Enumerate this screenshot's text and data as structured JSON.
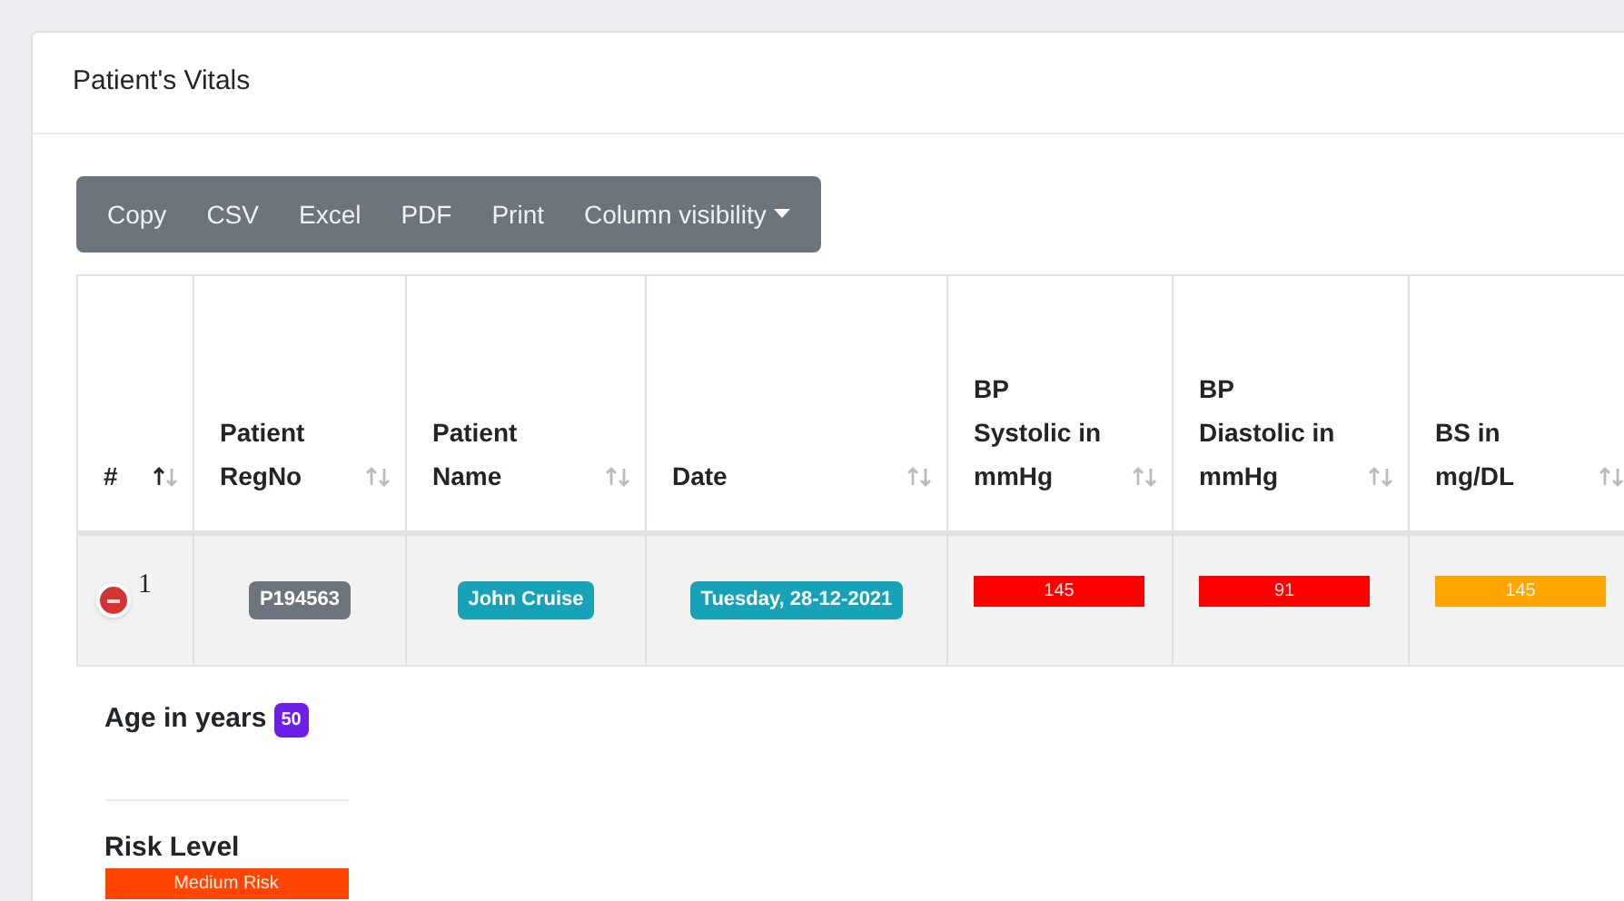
{
  "card": {
    "title": "Patient's Vitals"
  },
  "toolbar": {
    "buttons": [
      {
        "label": "Copy",
        "kind": "button"
      },
      {
        "label": "CSV",
        "kind": "button"
      },
      {
        "label": "Excel",
        "kind": "button"
      },
      {
        "label": "PDF",
        "kind": "button"
      },
      {
        "label": "Print",
        "kind": "button"
      },
      {
        "label": "Column visibility",
        "kind": "dropdown"
      }
    ]
  },
  "table": {
    "columns": [
      {
        "label": "#",
        "sorted": true
      },
      {
        "label": "Patient RegNo",
        "sorted": false
      },
      {
        "label": "Patient Name",
        "sorted": false
      },
      {
        "label": "Date",
        "sorted": false
      },
      {
        "label": "BP Systolic in mmHg",
        "sorted": false
      },
      {
        "label": "BP Diastolic in mmHg",
        "sorted": false
      },
      {
        "label": "BS in mg/DL",
        "sorted": false
      }
    ],
    "rows": [
      {
        "expanded": true,
        "cells": [
          {
            "kind": "number",
            "text": "1"
          },
          {
            "kind": "badge",
            "text": "P194563",
            "color": "#6c757d"
          },
          {
            "kind": "badge",
            "text": "John Cruise",
            "color": "#17a2b8"
          },
          {
            "kind": "badge",
            "text": "Tuesday, 28-12-2021",
            "color": "#17a2b8"
          },
          {
            "kind": "bar",
            "text": "145",
            "color": "#ff0000"
          },
          {
            "kind": "bar",
            "text": "91",
            "color": "#ff0000"
          },
          {
            "kind": "bar",
            "text": "145",
            "color": "#ffa500"
          }
        ],
        "details": {
          "age_label": "Age in years",
          "age": "50",
          "risk_label": "Risk Level",
          "risk": {
            "text": "Medium Risk",
            "color": "#ff4500"
          }
        }
      }
    ]
  }
}
